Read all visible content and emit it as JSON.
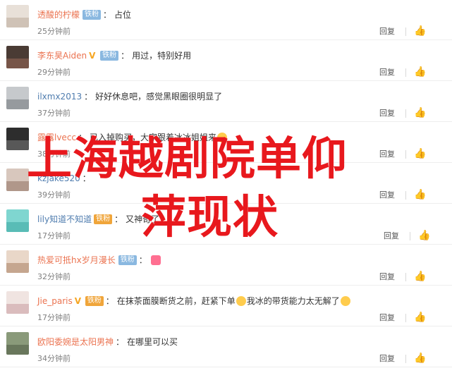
{
  "comments": [
    {
      "user": "透酸的柠檬",
      "v": false,
      "fan": "铁粉",
      "gold": "",
      "text": "占位",
      "time": "25分钟前",
      "emojis": 0
    },
    {
      "user": "李东昊Aiden",
      "v": true,
      "fan": "铁粉",
      "gold": "",
      "text": "用过，特别好用",
      "time": "29分钟前",
      "emojis": 0
    },
    {
      "user": "ilxmx2013",
      "v": false,
      "fan": "",
      "gold": "",
      "text": "好好休息吧，感觉黑眼圈很明显了",
      "time": "37分钟前",
      "emojis": 0
    },
    {
      "user": "露露lvecc",
      "v": false,
      "fan": "",
      "gold": "",
      "text": "已入掉购买，大家跟着冰冰姐姐来",
      "time": "38分钟前",
      "emojis": 1
    },
    {
      "user": "kzjake520",
      "v": false,
      "fan": "",
      "gold": "",
      "text": "",
      "time": "39分钟前",
      "emojis": 0
    },
    {
      "user": "lily知道不知道",
      "v": false,
      "fan": "",
      "gold": "铁粉",
      "text": "又神奇了",
      "time": "17分钟前",
      "emojis": 0
    },
    {
      "user": "热爱可抵hx岁月漫长",
      "v": false,
      "fan": "铁粉",
      "gold": "",
      "text": "",
      "time": "32分钟前",
      "emojis": 1
    },
    {
      "user": "Jie_paris",
      "v": true,
      "fan": "",
      "gold": "铁粉",
      "text": "在抹茶面膜断货之前，赶紧下单",
      "text2": "我冰的带货能力太无解了",
      "time": "17分钟前",
      "emojis": 1
    },
    {
      "user": "欧阳委婉是太阳男神",
      "v": false,
      "fan": "",
      "gold": "",
      "text": "在哪里可以买",
      "time": "34分钟前",
      "emojis": 0
    }
  ],
  "actions": {
    "reply": "回复",
    "like_icon": "thumbs-up-icon"
  },
  "watermark": {
    "line1": "上海越剧院单仰",
    "line2": "萍现状",
    "color": "#e8181d"
  },
  "colors": {
    "username": "#eb7350",
    "link": "#507daf",
    "fan_badge": "#8ab8e0",
    "gold_badge": "#f0a53a",
    "time": "#808080"
  }
}
